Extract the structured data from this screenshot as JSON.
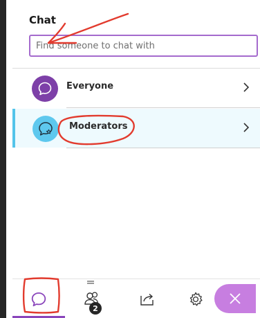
{
  "panel": {
    "title": "Chat",
    "search_placeholder": "Find someone to chat with"
  },
  "chats": [
    {
      "label": "Everyone",
      "icon": "chat-bubble-icon",
      "color": "#7d40a8"
    },
    {
      "label": "Moderators",
      "icon": "chat-bubble-star-icon",
      "color": "#5ec8ee",
      "selected": true
    }
  ],
  "bottom_nav": {
    "tabs": [
      {
        "name": "chat",
        "icon": "chat-bubble-icon",
        "active": true
      },
      {
        "name": "attendees",
        "icon": "people-icon",
        "badge": "2"
      },
      {
        "name": "share",
        "icon": "share-icon"
      },
      {
        "name": "settings",
        "icon": "gear-icon"
      },
      {
        "name": "close",
        "icon": "close-icon"
      }
    ]
  },
  "colors": {
    "accent": "#8a45bb",
    "search_border": "#a46acd",
    "moderators_highlight": "#53c4ea",
    "annotation_red": "#e23b2e"
  }
}
